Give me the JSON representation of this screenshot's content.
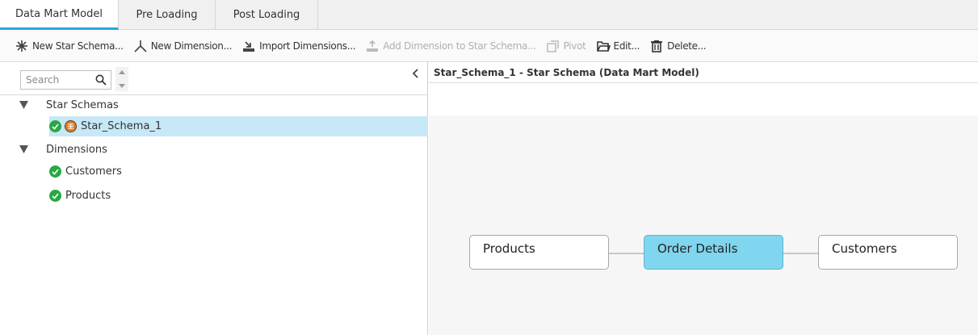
{
  "tabs": [
    {
      "label": "Data Mart Model",
      "active": true
    },
    {
      "label": "Pre Loading",
      "active": false
    },
    {
      "label": "Post Loading",
      "active": false
    }
  ],
  "toolbar": {
    "new_star_schema": "New Star Schema...",
    "new_dimension": "New Dimension...",
    "import_dimensions": "Import Dimensions...",
    "add_dimension": "Add Dimension to Star Schema...",
    "pivot": "Pivot",
    "edit": "Edit...",
    "delete": "Delete..."
  },
  "search": {
    "placeholder": "Search",
    "value": ""
  },
  "tree": {
    "star_schemas_label": "Star Schemas",
    "star_schemas": [
      {
        "label": "Star_Schema_1",
        "selected": true
      }
    ],
    "dimensions_label": "Dimensions",
    "dimensions": [
      {
        "label": "Customers"
      },
      {
        "label": "Products"
      }
    ]
  },
  "panel": {
    "title_name": "Star_Schema_1",
    "title_rest": " - Star Schema (Data Mart Model)"
  },
  "diagram": {
    "nodes": [
      {
        "label": "Products",
        "kind": "dimension"
      },
      {
        "label": "Order Details",
        "kind": "fact"
      },
      {
        "label": "Customers",
        "kind": "dimension"
      }
    ],
    "fact_color": "#7fd6ee"
  },
  "colors": {
    "accent": "#2aa6e0",
    "check": "#27a844",
    "selection": "#c6e8f7"
  },
  "icons": {
    "new_star_schema": "star-schema-icon",
    "new_dimension": "dimension-icon",
    "import": "import-icon",
    "add": "add-dimension-icon",
    "pivot": "pivot-icon",
    "edit": "folder-open-icon",
    "delete": "trash-icon"
  }
}
